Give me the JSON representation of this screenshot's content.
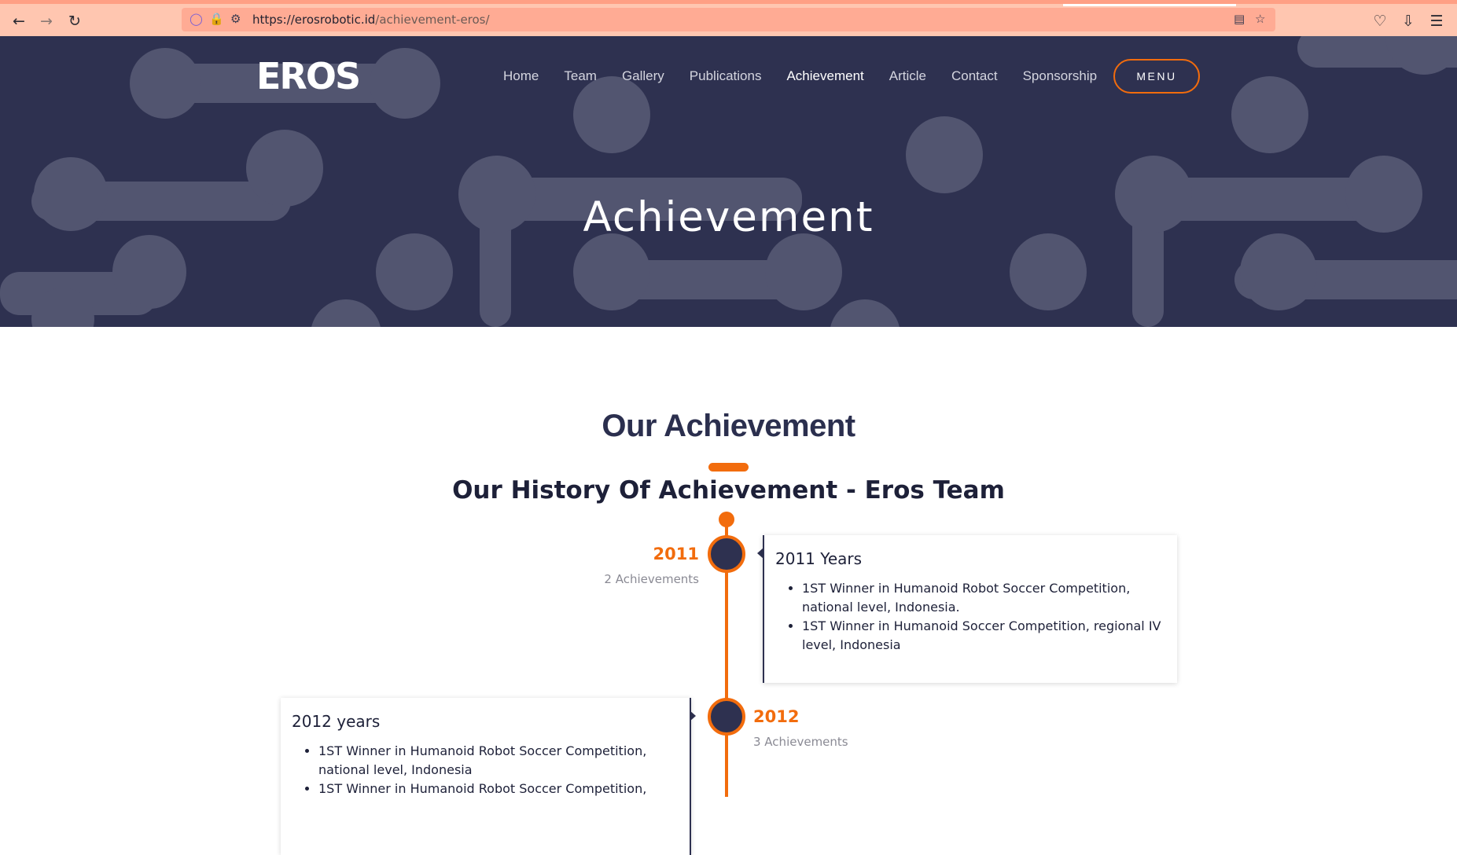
{
  "browser": {
    "url_host": "https://erosrobotic.id",
    "url_path": "/achievement-eros/",
    "icons": [
      "back-arrow-icon",
      "forward-arrow-icon",
      "reload-icon",
      "shield-icon",
      "lock-icon",
      "permissions-icon",
      "reader-mode-icon",
      "bookmark-star-icon",
      "pocket-icon",
      "download-icon",
      "hamburger-menu-icon"
    ]
  },
  "header": {
    "logo_text": "EROS",
    "nav": [
      "Home",
      "Team",
      "Gallery",
      "Publications",
      "Achievement",
      "Article",
      "Contact",
      "Sponsorship"
    ],
    "active_nav": "Achievement",
    "menu_label": "MENU"
  },
  "hero": {
    "title": "Achievement"
  },
  "section": {
    "title": "Our Achievement",
    "subtitle": "Our History Of Achievement - Eros Team"
  },
  "timeline": [
    {
      "year": "2011",
      "count": "2 Achievements",
      "card_title": "2011 Years",
      "items": [
        "1ST Winner in Humanoid Robot Soccer Competition, national level, Indonesia.",
        "1ST Winner in Humanoid Soccer Competition, regional IV level, Indonesia"
      ]
    },
    {
      "year": "2012",
      "count": "3 Achievements",
      "card_title": "2012 years",
      "items": [
        "1ST Winner in Humanoid Robot Soccer Competition, national level, Indonesia",
        "1ST Winner in Humanoid Robot Soccer Competition,"
      ]
    }
  ],
  "colors": {
    "accent": "#f26c0d",
    "navy": "#2e3150",
    "browser_bar": "#ffc6b0"
  }
}
